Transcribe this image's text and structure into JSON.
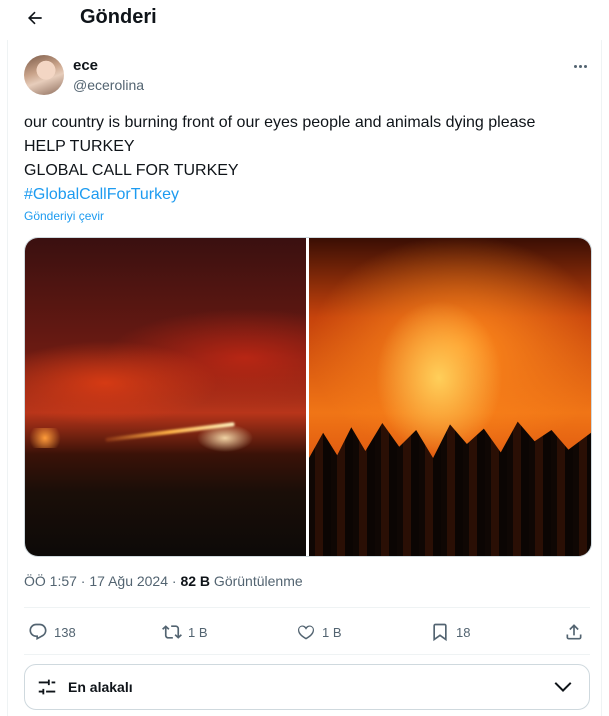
{
  "header": {
    "title": "Gönderi"
  },
  "author": {
    "name": "ece",
    "handle": "@ecerolina"
  },
  "post": {
    "lines": [
      "our country is burning front of our eyes people and animals dying please",
      "HELP TURKEY",
      "GLOBAL CALL FOR TURKEY"
    ],
    "hashtag": "#GlobalCallForTurkey",
    "translate_label": "Gönderiyi çevir"
  },
  "meta": {
    "time": "ÖÖ 1:57",
    "separator1": " · ",
    "date": "17 Ağu 2024",
    "separator2": " · ",
    "views_count": "82 B",
    "views_label": " Görüntülenme"
  },
  "actions": {
    "replies": "138",
    "reposts": "1 B",
    "likes": "1 B",
    "bookmarks": "18"
  },
  "sort": {
    "label": "En alakalı"
  },
  "colors": {
    "accent": "#1d9bf0",
    "muted": "#536471",
    "text": "#0f1419"
  },
  "icons": [
    "back-arrow-icon",
    "more-icon",
    "reply-icon",
    "repost-icon",
    "like-icon",
    "bookmark-icon",
    "share-icon",
    "sliders-icon",
    "chevron-down-icon"
  ]
}
